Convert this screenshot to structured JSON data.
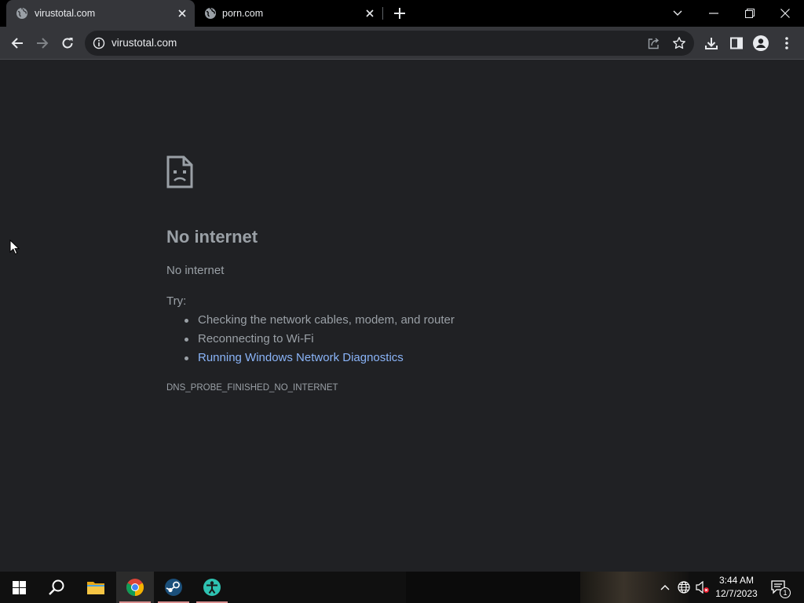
{
  "browser": {
    "tabs": [
      {
        "title": "virustotal.com",
        "active": true,
        "favicon": "globe-icon"
      },
      {
        "title": "porn.com",
        "active": false,
        "favicon": "globe-icon"
      }
    ],
    "address": "virustotal.com",
    "colors": {
      "tabstrip": "#000000",
      "toolbar": "#35363a",
      "content": "#202124",
      "link": "#8ab4f8"
    }
  },
  "error": {
    "title": "No internet",
    "subtitle": "No internet",
    "try_label": "Try:",
    "suggestions": [
      "Checking the network cables, modem, and router",
      "Reconnecting to Wi-Fi"
    ],
    "diagnostics_link": "Running Windows Network Diagnostics",
    "code": "DNS_PROBE_FINISHED_NO_INTERNET"
  },
  "taskbar": {
    "time": "3:44 AM",
    "date": "12/7/2023",
    "notification_count": "1",
    "pinned": [
      "start-icon",
      "search-icon",
      "file-explorer-icon",
      "chrome-icon",
      "steam-icon",
      "app-icon"
    ]
  }
}
